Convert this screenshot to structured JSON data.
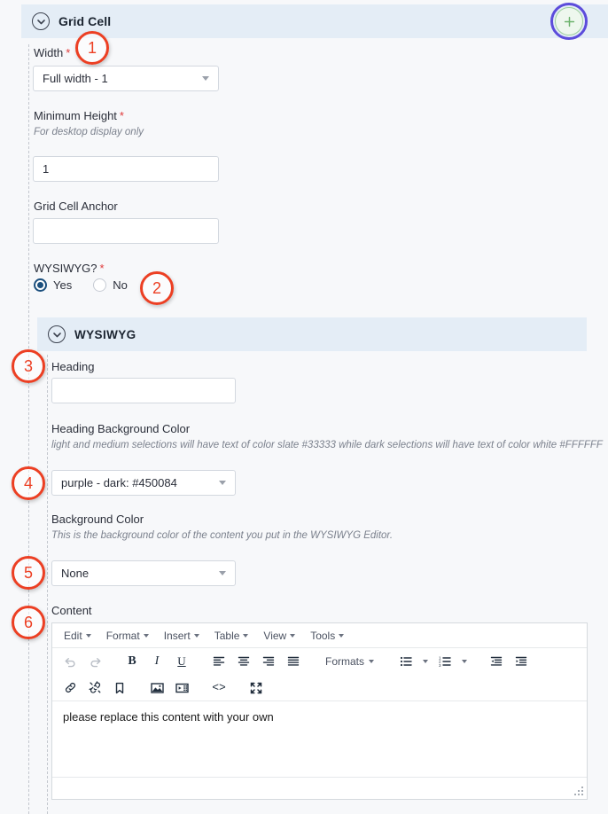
{
  "grid_cell_section": {
    "title": "Grid Cell",
    "collapse_icon": "chevron-down-icon",
    "add_icon": "plus-icon"
  },
  "fields": {
    "width": {
      "label": "Width",
      "required_mark": "*",
      "value": "Full width - 1"
    },
    "minimum_height": {
      "label": "Minimum Height",
      "required_mark": "*",
      "help": "For desktop display only",
      "value": "1"
    },
    "grid_cell_anchor": {
      "label": "Grid Cell Anchor",
      "value": ""
    },
    "wysiwyg_question": {
      "label": "WYSIWYG?",
      "required_mark": "*",
      "options": [
        {
          "label": "Yes",
          "selected": true
        },
        {
          "label": "No",
          "selected": false
        }
      ]
    }
  },
  "wysiwyg_section": {
    "title": "WYSIWYG",
    "collapse_icon": "chevron-down-icon",
    "heading": {
      "label": "Heading",
      "value": ""
    },
    "heading_background_color": {
      "label": "Heading Background Color",
      "help": "light and medium selections will have text of color slate #33333 while dark selections will have text of color white #FFFFFF",
      "value": "purple - dark: #450084"
    },
    "background_color": {
      "label": "Background Color",
      "help": "This is the background color of the content you put in the WYSIWYG Editor.",
      "value": "None"
    },
    "content": {
      "label": "Content"
    }
  },
  "editor": {
    "menubar": [
      {
        "label": "Edit",
        "icon": "caret-down-icon"
      },
      {
        "label": "Format",
        "icon": "caret-down-icon"
      },
      {
        "label": "Insert",
        "icon": "caret-down-icon"
      },
      {
        "label": "Table",
        "icon": "caret-down-icon"
      },
      {
        "label": "View",
        "icon": "caret-down-icon"
      },
      {
        "label": "Tools",
        "icon": "caret-down-icon"
      }
    ],
    "toolbar_row1": {
      "undo": "undo-icon",
      "redo": "redo-icon",
      "bold": "B",
      "italic": "I",
      "underline": "U",
      "align_left": "align-left-icon",
      "align_center": "align-center-icon",
      "align_right": "align-right-icon",
      "align_justify": "align-justify-icon",
      "formats_label": "Formats",
      "bullet_list": "bullet-list-icon",
      "numbered_list": "numbered-list-icon",
      "outdent": "outdent-icon",
      "indent": "indent-icon"
    },
    "toolbar_row2": {
      "link": "link-icon",
      "unlink": "unlink-icon",
      "anchor": "anchor-bookmark-icon",
      "image": "image-icon",
      "media": "media-icon",
      "source_code": "<>",
      "fullscreen": "fullscreen-icon"
    },
    "body_text": "please replace this content with your own",
    "resize_grip": "resize-grip-icon"
  },
  "annotations": [
    {
      "number": "1"
    },
    {
      "number": "2"
    },
    {
      "number": "3"
    },
    {
      "number": "4"
    },
    {
      "number": "5"
    },
    {
      "number": "6"
    }
  ],
  "colors": {
    "section_header_bg": "#e4edf6",
    "page_bg": "#f7f8fa",
    "required_red": "#e03a3a",
    "annotation_red": "#ec3f23",
    "focus_ring_purple": "#5c4cdb",
    "add_button_green": "#6db36d",
    "radio_selected": "#1b4f7d"
  }
}
